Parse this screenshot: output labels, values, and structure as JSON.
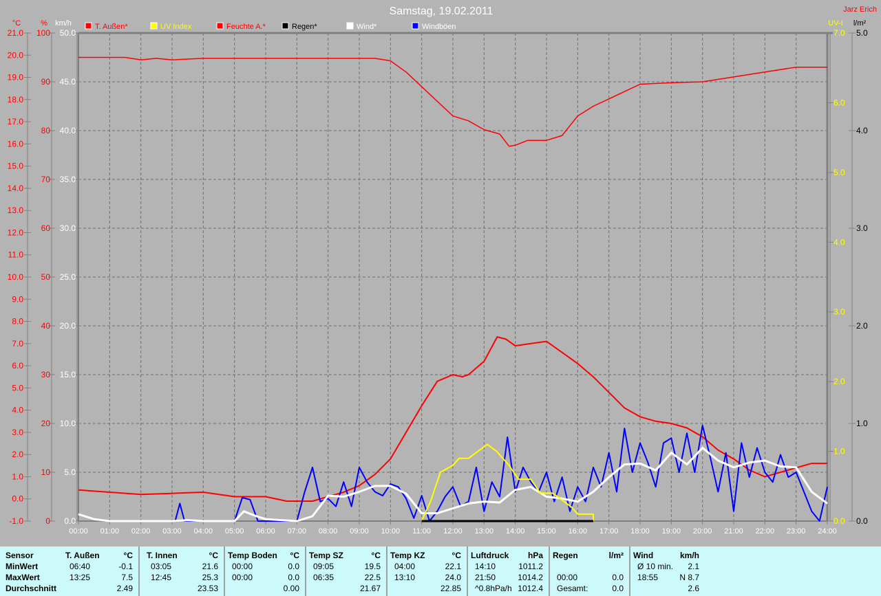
{
  "title": "Samstag, 19.02.2011",
  "author": "Jarz Erich",
  "colors": {
    "temp": "#ff0000",
    "uv": "#ffff00",
    "humidity": "#ff0000",
    "rain": "#000000",
    "wind": "#ffffff",
    "gust": "#0000ff",
    "grid": "#6e6e6e",
    "background": "#b4b4b4",
    "table": "#ccfafa"
  },
  "legend": [
    {
      "label": "T. Außen*",
      "color": "#ff0000",
      "text_color": "#ff0000"
    },
    {
      "label": "UV Index",
      "color": "#ffff00",
      "text_color": "#ffff00"
    },
    {
      "label": "Feuchte A.*",
      "color": "#ff0000",
      "text_color": "#ff0000"
    },
    {
      "label": "Regen*",
      "color": "#000000",
      "text_color": "#000000"
    },
    {
      "label": "Wind*",
      "color": "#ffffff",
      "text_color": "#ffffff"
    },
    {
      "label": "Windböen",
      "color": "#0000ff",
      "text_color": "#ffffff"
    }
  ],
  "chart_data": {
    "type": "line",
    "title": "Samstag, 19.02.2011",
    "x_unit": "hour",
    "xlim": [
      0,
      24
    ],
    "x_ticks": [
      "00:00",
      "01:00",
      "02:00",
      "03:00",
      "04:00",
      "05:00",
      "06:00",
      "07:00",
      "08:00",
      "09:00",
      "10:00",
      "11:00",
      "12:00",
      "13:00",
      "14:00",
      "15:00",
      "16:00",
      "17:00",
      "18:00",
      "19:00",
      "20:00",
      "21:00",
      "22:00",
      "23:00",
      "24:00"
    ],
    "axes": {
      "temp": {
        "unit": "°C",
        "range": [
          -1,
          21
        ],
        "ticks": [
          "-1.0",
          "0.0",
          "1.0",
          "2.0",
          "3.0",
          "4.0",
          "5.0",
          "6.0",
          "7.0",
          "8.0",
          "9.0",
          "10.0",
          "11.0",
          "12.0",
          "13.0",
          "14.0",
          "15.0",
          "16.0",
          "17.0",
          "18.0",
          "19.0",
          "20.0",
          "21.0"
        ]
      },
      "humidity": {
        "unit": "%",
        "range": [
          0,
          100
        ],
        "ticks": [
          "0",
          "10",
          "20",
          "30",
          "40",
          "50",
          "60",
          "70",
          "80",
          "90",
          "100"
        ]
      },
      "wind": {
        "unit": "km/h",
        "range": [
          0,
          50
        ],
        "ticks": [
          "0.0",
          "5.0",
          "10.0",
          "15.0",
          "20.0",
          "25.0",
          "30.0",
          "35.0",
          "40.0",
          "45.0",
          "50.0"
        ]
      },
      "uv": {
        "unit": "UV-I",
        "range": [
          0,
          7
        ],
        "ticks": [
          "0.0",
          "1.0",
          "2.0",
          "3.0",
          "4.0",
          "5.0",
          "6.0",
          "7.0"
        ]
      },
      "rain": {
        "unit": "l/m²",
        "range": [
          0,
          5
        ],
        "ticks": [
          "0.0",
          "1.0",
          "2.0",
          "3.0",
          "4.0",
          "5.0"
        ]
      }
    },
    "grid": true,
    "series": [
      {
        "name": "T. Außen*",
        "axis": "temp",
        "color": "#ff0000",
        "points": [
          [
            0,
            0.4
          ],
          [
            1,
            0.3
          ],
          [
            2,
            0.2
          ],
          [
            3,
            0.25
          ],
          [
            4,
            0.3
          ],
          [
            5,
            0.1
          ],
          [
            6,
            0.1
          ],
          [
            6.67,
            -0.1
          ],
          [
            7.5,
            -0.1
          ],
          [
            8.5,
            0.3
          ],
          [
            9,
            0.6
          ],
          [
            9.5,
            1.1
          ],
          [
            10,
            1.8
          ],
          [
            10.5,
            3.0
          ],
          [
            11,
            4.2
          ],
          [
            11.5,
            5.3
          ],
          [
            12,
            5.6
          ],
          [
            12.3,
            5.5
          ],
          [
            12.5,
            5.6
          ],
          [
            13,
            6.2
          ],
          [
            13.42,
            7.3
          ],
          [
            13.7,
            7.2
          ],
          [
            14,
            6.9
          ],
          [
            14.5,
            7.0
          ],
          [
            15,
            7.1
          ],
          [
            15.5,
            6.6
          ],
          [
            16,
            6.1
          ],
          [
            16.5,
            5.5
          ],
          [
            17,
            4.8
          ],
          [
            17.5,
            4.1
          ],
          [
            18,
            3.7
          ],
          [
            18.5,
            3.5
          ],
          [
            19,
            3.4
          ],
          [
            19.5,
            3.2
          ],
          [
            20,
            2.8
          ],
          [
            20.5,
            2.2
          ],
          [
            21,
            1.8
          ],
          [
            21.5,
            1.3
          ],
          [
            22,
            1.0
          ],
          [
            22.5,
            1.2
          ],
          [
            23,
            1.4
          ],
          [
            23.5,
            1.6
          ],
          [
            24,
            1.6
          ]
        ]
      },
      {
        "name": "UV Index",
        "axis": "uv",
        "color": "#ffff00",
        "points": [
          [
            11,
            0
          ],
          [
            11.3,
            0.3
          ],
          [
            11.6,
            0.7
          ],
          [
            12,
            0.8
          ],
          [
            12.2,
            0.9
          ],
          [
            12.5,
            0.9
          ],
          [
            12.8,
            1.0
          ],
          [
            13.1,
            1.1
          ],
          [
            13.4,
            1.0
          ],
          [
            13.8,
            0.8
          ],
          [
            14.1,
            0.6
          ],
          [
            14.5,
            0.6
          ],
          [
            14.8,
            0.4
          ],
          [
            15.2,
            0.4
          ],
          [
            15.5,
            0.3
          ],
          [
            15.8,
            0.2
          ],
          [
            16,
            0.1
          ],
          [
            16.5,
            0.1
          ],
          [
            16.5,
            0
          ]
        ]
      },
      {
        "name": "Feuchte A.*",
        "axis": "humidity",
        "color": "#ff0000",
        "points": [
          [
            0,
            95
          ],
          [
            1.5,
            95
          ],
          [
            2,
            94.5
          ],
          [
            2.5,
            94.8
          ],
          [
            3,
            94.5
          ],
          [
            4,
            94.8
          ],
          [
            9.5,
            94.8
          ],
          [
            10,
            94.3
          ],
          [
            10.5,
            92
          ],
          [
            11,
            89
          ],
          [
            11.5,
            86
          ],
          [
            12,
            83
          ],
          [
            12.5,
            82
          ],
          [
            13,
            80.2
          ],
          [
            13.5,
            79.3
          ],
          [
            13.8,
            76.8
          ],
          [
            14,
            77
          ],
          [
            14.4,
            78
          ],
          [
            15,
            78
          ],
          [
            15.5,
            79
          ],
          [
            16,
            83
          ],
          [
            16.5,
            85
          ],
          [
            17,
            86.5
          ],
          [
            17.5,
            88
          ],
          [
            18,
            89.5
          ],
          [
            19,
            89.8
          ],
          [
            20,
            90
          ],
          [
            21,
            91
          ],
          [
            22,
            92
          ],
          [
            23,
            93
          ],
          [
            24,
            93
          ]
        ]
      },
      {
        "name": "Regen*",
        "axis": "rain",
        "color": "#000000",
        "points": [
          [
            11,
            0
          ],
          [
            16.5,
            0
          ]
        ]
      },
      {
        "name": "Wind*",
        "axis": "wind",
        "color": "#ffffff",
        "points": [
          [
            0,
            0.7
          ],
          [
            0.5,
            0.2
          ],
          [
            1,
            0
          ],
          [
            3,
            0
          ],
          [
            3.5,
            0.1
          ],
          [
            4,
            0
          ],
          [
            5,
            0
          ],
          [
            5.3,
            1
          ],
          [
            5.7,
            0.5
          ],
          [
            6,
            0.2
          ],
          [
            7,
            0
          ],
          [
            7.5,
            0.5
          ],
          [
            8,
            2.6
          ],
          [
            8.5,
            2.5
          ],
          [
            9,
            3
          ],
          [
            9.5,
            3.6
          ],
          [
            10,
            3.6
          ],
          [
            10.5,
            2.8
          ],
          [
            11,
            0.8
          ],
          [
            11.5,
            0.8
          ],
          [
            12,
            1.3
          ],
          [
            12.5,
            1.8
          ],
          [
            13,
            2.0
          ],
          [
            13.5,
            1.9
          ],
          [
            14,
            3.2
          ],
          [
            14.5,
            3.5
          ],
          [
            15,
            2.5
          ],
          [
            15.5,
            2.3
          ],
          [
            16,
            2.0
          ],
          [
            16.5,
            3.0
          ],
          [
            17,
            4.5
          ],
          [
            17.5,
            5.8
          ],
          [
            18,
            5.9
          ],
          [
            18.5,
            5.2
          ],
          [
            19,
            7.0
          ],
          [
            19.5,
            5.8
          ],
          [
            20,
            7.5
          ],
          [
            20.5,
            6.2
          ],
          [
            21,
            5.5
          ],
          [
            21.5,
            6.0
          ],
          [
            22,
            6.2
          ],
          [
            22.5,
            5.6
          ],
          [
            23,
            5.5
          ],
          [
            23.5,
            3.0
          ],
          [
            24,
            1.8
          ]
        ]
      },
      {
        "name": "Windböen",
        "axis": "wind",
        "color": "#0000ff",
        "points": [
          [
            3.1,
            0
          ],
          [
            3.25,
            1.8
          ],
          [
            3.4,
            0
          ],
          [
            5,
            0
          ],
          [
            5.25,
            2.4
          ],
          [
            5.5,
            2.2
          ],
          [
            5.75,
            0
          ],
          [
            7,
            0
          ],
          [
            7.25,
            3
          ],
          [
            7.5,
            5.5
          ],
          [
            7.75,
            2
          ],
          [
            8,
            2.3
          ],
          [
            8.25,
            1.5
          ],
          [
            8.5,
            4
          ],
          [
            8.75,
            1.5
          ],
          [
            9,
            5.5
          ],
          [
            9.25,
            4
          ],
          [
            9.5,
            3
          ],
          [
            9.75,
            2.6
          ],
          [
            10,
            3.8
          ],
          [
            10.25,
            3.5
          ],
          [
            10.5,
            2.3
          ],
          [
            10.75,
            0.3
          ],
          [
            11,
            2.6
          ],
          [
            11.25,
            0
          ],
          [
            11.5,
            1
          ],
          [
            11.75,
            2.5
          ],
          [
            12,
            3.5
          ],
          [
            12.25,
            1.5
          ],
          [
            12.5,
            2
          ],
          [
            12.75,
            5.5
          ],
          [
            13,
            1
          ],
          [
            13.25,
            4
          ],
          [
            13.5,
            2.5
          ],
          [
            13.75,
            8.6
          ],
          [
            14,
            3
          ],
          [
            14.25,
            5.5
          ],
          [
            14.5,
            4
          ],
          [
            14.75,
            3
          ],
          [
            15,
            5
          ],
          [
            15.25,
            2
          ],
          [
            15.5,
            4.5
          ],
          [
            15.75,
            1
          ],
          [
            16,
            3.5
          ],
          [
            16.25,
            2
          ],
          [
            16.5,
            5.5
          ],
          [
            16.75,
            3.5
          ],
          [
            17,
            7
          ],
          [
            17.25,
            3
          ],
          [
            17.5,
            9.5
          ],
          [
            17.75,
            5
          ],
          [
            18,
            8
          ],
          [
            18.25,
            6
          ],
          [
            18.5,
            3.5
          ],
          [
            18.75,
            8
          ],
          [
            19,
            8.5
          ],
          [
            19.25,
            5
          ],
          [
            19.5,
            9
          ],
          [
            19.75,
            5
          ],
          [
            20,
            9.8
          ],
          [
            20.25,
            6.5
          ],
          [
            20.5,
            3
          ],
          [
            20.75,
            7
          ],
          [
            21,
            1
          ],
          [
            21.25,
            8
          ],
          [
            21.5,
            4.5
          ],
          [
            21.75,
            7.5
          ],
          [
            22,
            5
          ],
          [
            22.25,
            4
          ],
          [
            22.5,
            6.8
          ],
          [
            22.75,
            4.5
          ],
          [
            23,
            5
          ],
          [
            23.25,
            3
          ],
          [
            23.5,
            1
          ],
          [
            23.75,
            0
          ],
          [
            24,
            3.5
          ]
        ]
      }
    ]
  },
  "table": {
    "row_labels": [
      "Sensor",
      "MinWert",
      "MaxWert",
      "Durchschnitt"
    ],
    "columns": [
      {
        "header": "T. Außen",
        "unit": "°C",
        "rows": [
          [
            "06:40",
            "-0.1"
          ],
          [
            "13:25",
            "7.5"
          ],
          [
            "",
            "2.49"
          ]
        ]
      },
      {
        "header": "T. Innen",
        "unit": "°C",
        "rows": [
          [
            "03:05",
            "21.6"
          ],
          [
            "12:45",
            "25.3"
          ],
          [
            "",
            "23.53"
          ]
        ]
      },
      {
        "header": "Temp Boden",
        "unit": "°C",
        "rows": [
          [
            "00:00",
            "0.0"
          ],
          [
            "00:00",
            "0.0"
          ],
          [
            "",
            "0.00"
          ]
        ]
      },
      {
        "header": "Temp SZ",
        "unit": "°C",
        "rows": [
          [
            "09:05",
            "19.5"
          ],
          [
            "06:35",
            "22.5"
          ],
          [
            "",
            "21.67"
          ]
        ]
      },
      {
        "header": "Temp KZ",
        "unit": "°C",
        "rows": [
          [
            "04:00",
            "22.1"
          ],
          [
            "13:10",
            "24.0"
          ],
          [
            "",
            "22.85"
          ]
        ]
      },
      {
        "header": "Luftdruck",
        "unit": "hPa",
        "rows": [
          [
            "14:10",
            "1011.2"
          ],
          [
            "21:50",
            "1014.2"
          ],
          [
            "^0.8hPa/h",
            "1012.4"
          ]
        ]
      },
      {
        "header": "Regen",
        "unit": "l/m²",
        "rows": [
          [
            "",
            ""
          ],
          [
            "00:00",
            "0.0"
          ],
          [
            "Gesamt:",
            "0.0"
          ]
        ]
      },
      {
        "header": "Wind",
        "unit": "km/h",
        "rows": [
          [
            "Ø 10 min.",
            "2.1"
          ],
          [
            "18:55",
            "N 8.7"
          ],
          [
            "",
            "2.6"
          ]
        ]
      }
    ]
  }
}
